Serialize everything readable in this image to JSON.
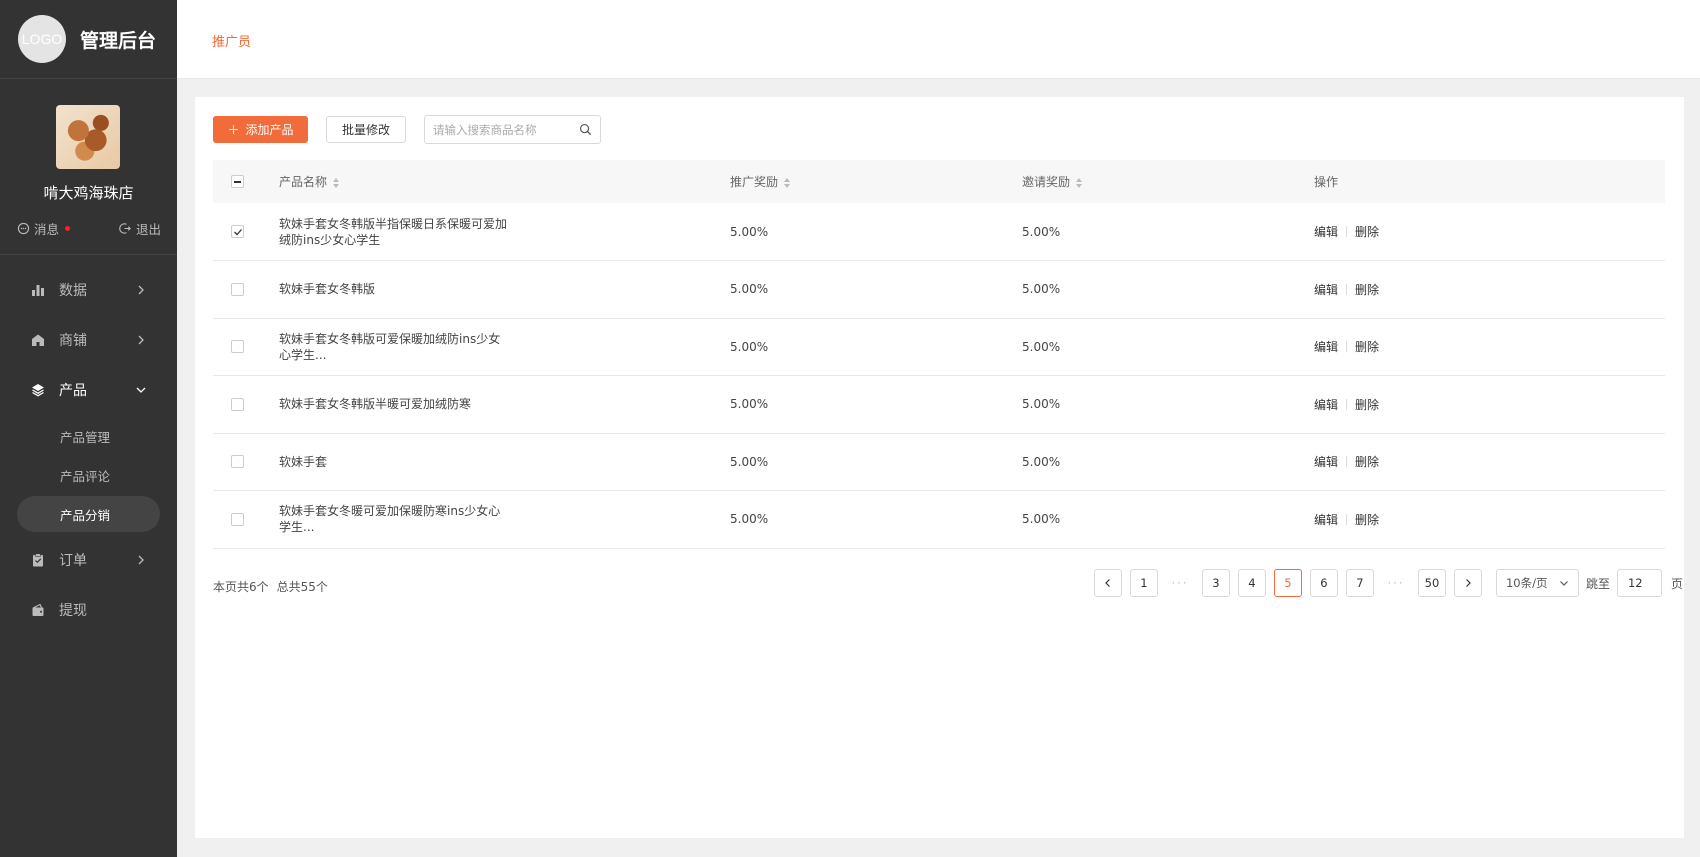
{
  "brand": {
    "logo_text": "LOGO",
    "title": "管理后台"
  },
  "profile": {
    "shop_name": "啃大鸡海珠店",
    "message_label": "消息",
    "logout_label": "退出"
  },
  "menu": [
    {
      "label": "数据",
      "icon": "bar-chart-icon"
    },
    {
      "label": "商铺",
      "icon": "shop-icon"
    },
    {
      "label": "产品",
      "icon": "layers-icon",
      "expanded": true,
      "children": [
        {
          "label": "产品管理"
        },
        {
          "label": "产品评论"
        },
        {
          "label": "产品分销",
          "active": true
        }
      ]
    },
    {
      "label": "订单",
      "icon": "clipboard-icon"
    },
    {
      "label": "提现",
      "icon": "wallet-icon"
    }
  ],
  "header": {
    "title": "推广员"
  },
  "toolbar": {
    "add_label": "添加产品",
    "batch_label": "批量修改",
    "search_placeholder": "请输入搜索商品名称"
  },
  "table": {
    "columns": [
      "产品名称",
      "推广奖励",
      "邀请奖励",
      "操作"
    ],
    "edit_label": "编辑",
    "delete_label": "删除",
    "rows": [
      {
        "name": "软妹手套女冬韩版半指保暖日系保暖可爱加绒防ins少女心学生",
        "reward": "5.00%",
        "invite": "5.00%",
        "checked": true
      },
      {
        "name": "软妹手套女冬韩版",
        "reward": "5.00%",
        "invite": "5.00%",
        "checked": false
      },
      {
        "name": "软妹手套女冬韩版可爱保暖加绒防ins少女心学生...",
        "reward": "5.00%",
        "invite": "5.00%",
        "checked": false
      },
      {
        "name": "软妹手套女冬韩版半暖可爱加绒防寒",
        "reward": "5.00%",
        "invite": "5.00%",
        "checked": false
      },
      {
        "name": "软妹手套",
        "reward": "5.00%",
        "invite": "5.00%",
        "checked": false
      },
      {
        "name": "软妹手套女冬暖可爱加保暖防寒ins少女心学生...",
        "reward": "5.00%",
        "invite": "5.00%",
        "checked": false
      }
    ]
  },
  "footer": {
    "page_count_text": "本页共6个",
    "total_text": "总共55个",
    "pages": [
      "1",
      "···",
      "3",
      "4",
      "5",
      "6",
      "7",
      "···",
      "50"
    ],
    "current_page": "5",
    "page_size": "10条/页",
    "jump_label": "跳至",
    "jump_value": "12",
    "page_suffix": "页"
  },
  "colors": {
    "accent": "#f26b3a",
    "sidebar_bg": "#333333"
  }
}
